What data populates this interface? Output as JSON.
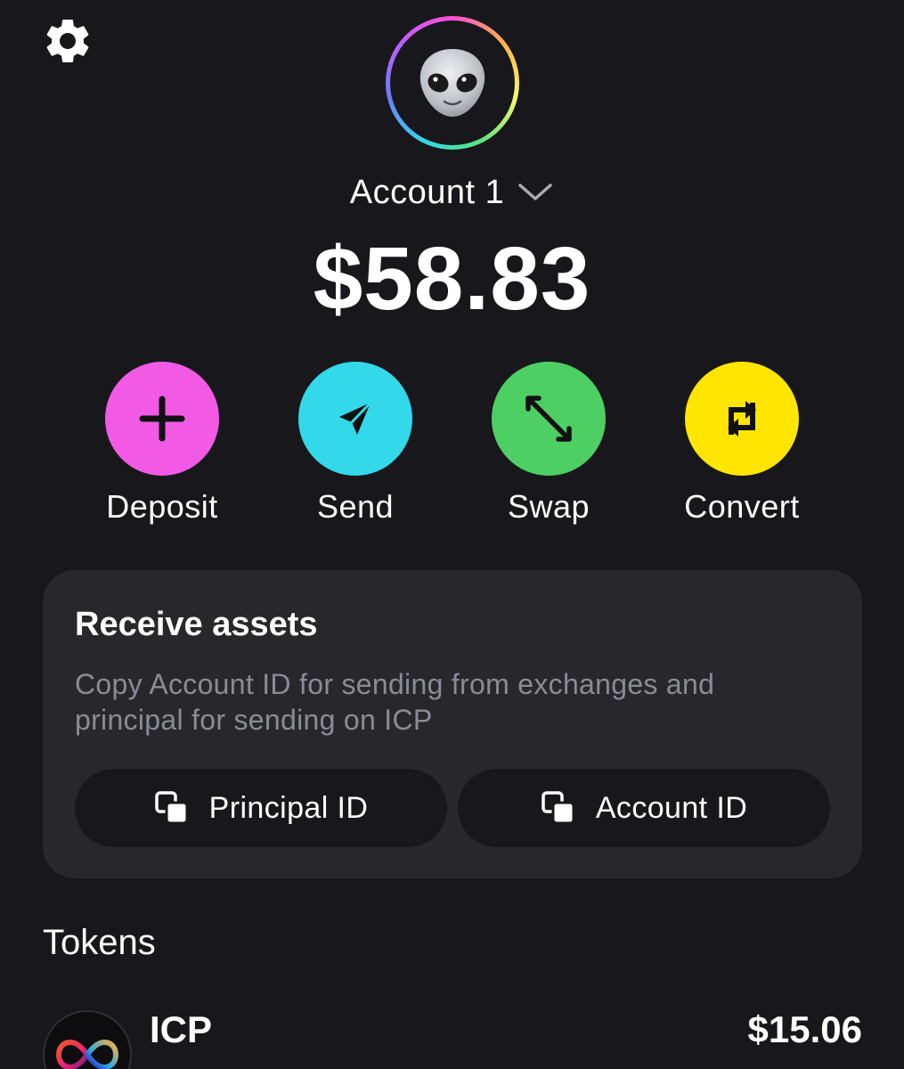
{
  "header": {
    "settings_icon": "gear-icon",
    "avatar_emoji": "👽",
    "account_name": "Account 1",
    "balance": "$58.83"
  },
  "actions": [
    {
      "label": "Deposit",
      "icon": "plus-icon",
      "color": "#f25ae6"
    },
    {
      "label": "Send",
      "icon": "paper-plane-icon",
      "color": "#33d8ea"
    },
    {
      "label": "Swap",
      "icon": "swap-arrows-icon",
      "color": "#4ecf63"
    },
    {
      "label": "Convert",
      "icon": "convert-arrows-icon",
      "color": "#ffe500"
    }
  ],
  "receive": {
    "title": "Receive assets",
    "description": "Copy Account ID for sending from exchanges and principal for sending on ICP",
    "principal_button": "Principal ID",
    "account_button": "Account ID"
  },
  "tokens": {
    "title": "Tokens",
    "items": [
      {
        "name": "ICP",
        "value": "$15.06",
        "icon": "infinity-icon"
      }
    ]
  }
}
